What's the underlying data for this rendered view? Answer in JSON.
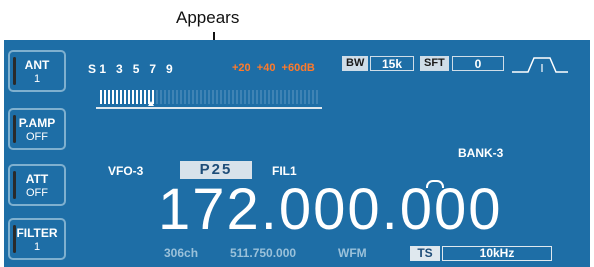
{
  "annotation": {
    "text": "Appears"
  },
  "side_buttons": [
    {
      "id": "ant",
      "title": "ANT",
      "value": "1"
    },
    {
      "id": "pamp",
      "title": "P.AMP",
      "value": "OFF"
    },
    {
      "id": "att",
      "title": "ATT",
      "value": "OFF"
    },
    {
      "id": "filter",
      "title": "FILTER",
      "value": "1"
    }
  ],
  "smeter": {
    "scale_white": "S 1   3   5   7   9",
    "scale_orange": "+20  +40  +60dB"
  },
  "bw": {
    "label": "BW",
    "value": "15k"
  },
  "sft": {
    "label": "SFT",
    "value": "0"
  },
  "vfo_label": "VFO-3",
  "memory_channel": "P25",
  "filter_label": "FIL1",
  "bank_label": "BANK-3",
  "frequency": "172.000.000",
  "bottom": {
    "channels": "306ch",
    "second_freq": "511.750.000",
    "mode": "WFM"
  },
  "ts": {
    "label": "TS",
    "value": "10kHz"
  },
  "colors": {
    "panel": "#1e6ea6",
    "scale_orange": "#ff7a2a",
    "text": "#ffffff"
  }
}
